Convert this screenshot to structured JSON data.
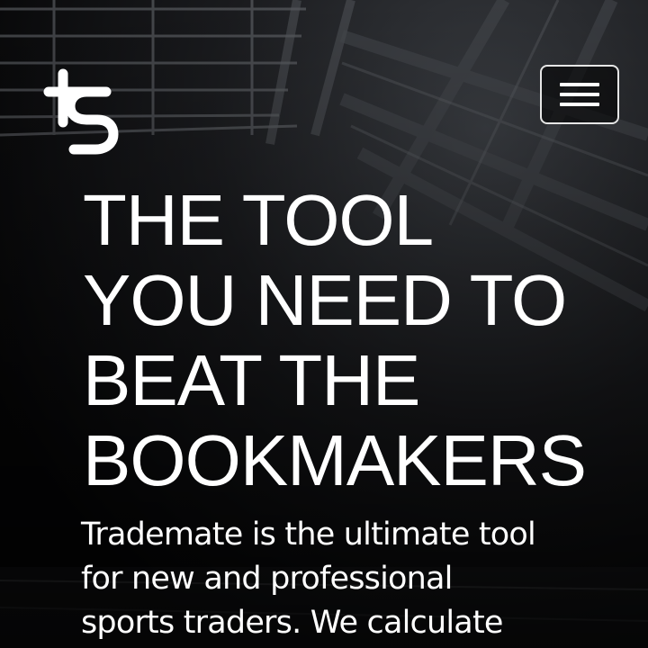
{
  "header": {
    "logo_icon": "ts-monogram-logo-icon",
    "menu_icon": "hamburger-menu-icon"
  },
  "hero": {
    "headline_lines": [
      "THE TOOL",
      "YOU NEED TO",
      "BEAT THE",
      "BOOKMAKERS"
    ],
    "description_lines": [
      "Tradematе is the ultimate tool",
      "for new and professional",
      "sports traders. We calculate"
    ]
  },
  "colors": {
    "text": "#ffffff",
    "background": "#0b0b0c",
    "button_border": "#e6e6e6"
  }
}
